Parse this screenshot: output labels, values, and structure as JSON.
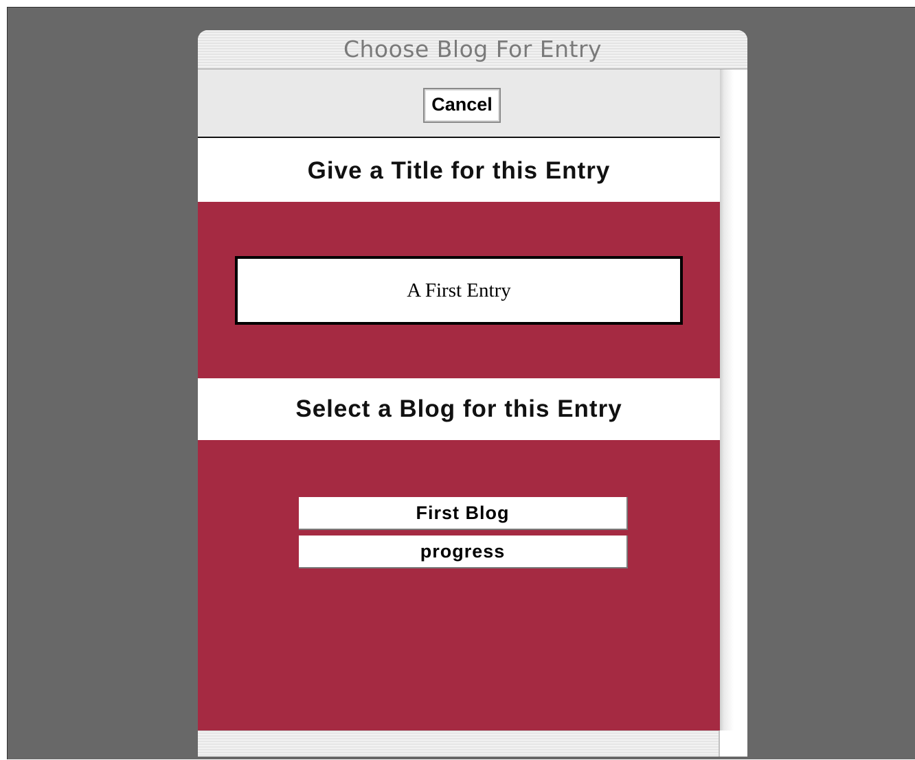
{
  "window": {
    "title": "Choose Blog For Entry"
  },
  "toolbar": {
    "cancel_label": "Cancel"
  },
  "title_section": {
    "heading": "Give a Title for this Entry",
    "input_value": "A First Entry"
  },
  "blog_section": {
    "heading": "Select a Blog for this Entry",
    "blogs": [
      {
        "label": "First Blog"
      },
      {
        "label": "progress"
      }
    ]
  },
  "colors": {
    "panel_background": "#a52a42",
    "desktop_background": "#686868"
  }
}
